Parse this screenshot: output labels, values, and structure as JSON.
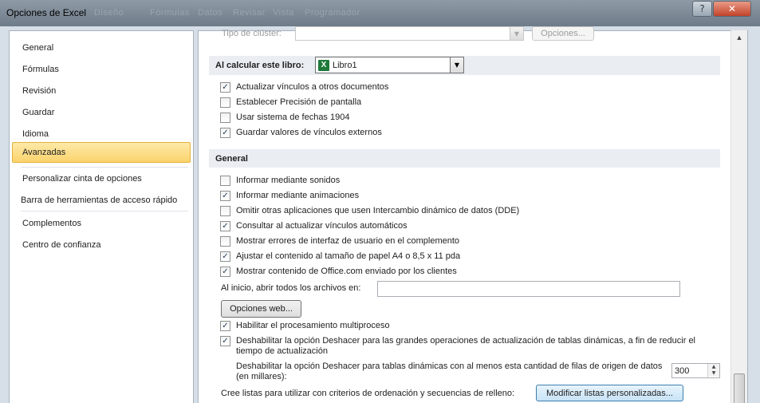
{
  "window": {
    "title": "Opciones de Excel",
    "ghost_text": [
      "Diseño",
      "Fórmulas",
      "Datos",
      "Revisar",
      "Vista",
      "Programador"
    ],
    "help_label": "?",
    "close_label": "✕"
  },
  "sidebar": {
    "items": [
      {
        "label": "General"
      },
      {
        "label": "Fórmulas"
      },
      {
        "label": "Revisión"
      },
      {
        "label": "Guardar"
      },
      {
        "label": "Idioma"
      },
      {
        "label": "Avanzadas"
      },
      {
        "label": "Personalizar cinta de opciones"
      },
      {
        "label": "Barra de herramientas de acceso rápido"
      },
      {
        "label": "Complementos"
      },
      {
        "label": "Centro de confianza"
      }
    ],
    "active": "Avanzadas"
  },
  "top_partial": {
    "cluster_label": "Tipo de clúster:",
    "options_button": "Opciones..."
  },
  "calc_section": {
    "header": "Al calcular este libro:",
    "workbook": "Libro1",
    "checks": [
      {
        "label": "Actualizar vínculos a otros documentos",
        "checked": true
      },
      {
        "label": "Establecer Precisión de pantalla",
        "checked": false
      },
      {
        "label": "Usar sistema de fechas 1904",
        "checked": false
      },
      {
        "label": "Guardar valores de vínculos externos",
        "checked": true
      }
    ]
  },
  "general_section": {
    "header": "General",
    "checks": [
      {
        "label": "Informar mediante sonidos",
        "checked": false
      },
      {
        "label": "Informar mediante animaciones",
        "checked": true
      },
      {
        "label": "Omitir otras aplicaciones que usen Intercambio dinámico de datos (DDE)",
        "checked": false
      },
      {
        "label": "Consultar al actualizar vínculos automáticos",
        "checked": true
      },
      {
        "label": "Mostrar errores de interfaz de usuario en el complemento",
        "checked": false
      },
      {
        "label": "Ajustar el contenido al tamaño de papel A4 o 8,5 x 11 pda",
        "checked": true
      },
      {
        "label": "Mostrar contenido de Office.com enviado por los clientes",
        "checked": true
      }
    ],
    "startup_label": "Al inicio, abrir todos los archivos en:",
    "startup_value": "",
    "web_options_button": "Opciones web...",
    "multiprocess": {
      "label": "Habilitar el procesamiento multiproceso",
      "checked": true
    },
    "undo_pivot": {
      "label": "Deshabilitar la opción Deshacer para las grandes operaciones de actualización de tablas dinámicas, a fin de reducir el tiempo de actualización",
      "checked": true
    },
    "undo_rows_label": "Deshabilitar la opción Deshacer para tablas dinámicas con al menos esta cantidad de filas de origen de datos (en millares):",
    "undo_rows_value": "300",
    "lists_label": "Cree listas para utilizar con criterios de ordenación y secuencias de relleno:",
    "lists_button": "Modificar listas personalizadas..."
  },
  "icons": {
    "check": "✓",
    "dropdown_arrow": "▼",
    "scroll_up": "▲",
    "spin_up": "▲",
    "spin_down": "▼",
    "excel_icon": "X"
  },
  "colors": {
    "active_nav": "#fbd36d",
    "section_header_bg": "#eaeef3",
    "excel_green": "#1f7a3a"
  }
}
